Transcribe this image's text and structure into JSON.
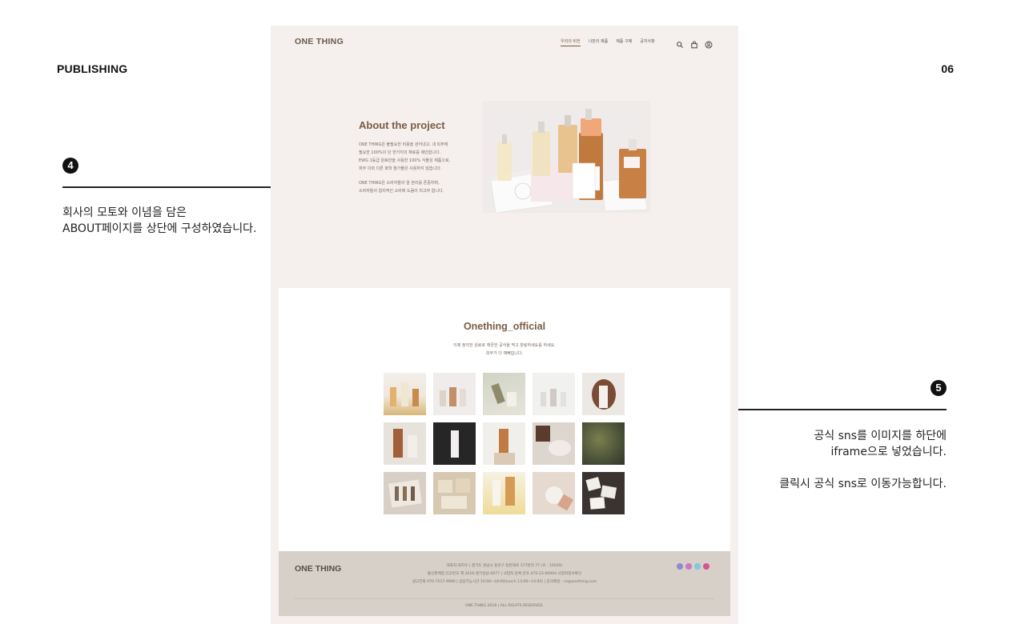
{
  "slide": {
    "section_label": "PUBLISHING",
    "page_number": "06"
  },
  "annotations": [
    {
      "badge": "4",
      "lines": [
        "회사의 모토와 이념을 담은",
        "ABOUT페이지를 상단에 구성하였습니다."
      ]
    },
    {
      "badge": "5",
      "lines": [
        "공식 sns를 이미지를 하단에",
        "iframe으로 넣었습니다.",
        "",
        "클릭시 공식 sns로 이동가능합니다."
      ]
    }
  ],
  "site": {
    "logo": "ONE THING",
    "nav": [
      "우리의 비전",
      "나만의 제품",
      "제품 구매",
      "공지사항"
    ],
    "nav_active_index": 0,
    "nav_icons": [
      "search-icon",
      "bag-icon",
      "user-icon"
    ],
    "about": {
      "title": "About the project",
      "paragraph1": [
        "ONE THING은 불필요한 비용을 걷어내고, 내 피부에",
        "필요한 100%의 단 한가지의 재료를 제안합니다.",
        "EWG 1등급 원료만을 사용한 100% 식물성 제품으로,",
        "피부 이외 다른 화학 첨가물은 사용하지 않습니다."
      ],
      "paragraph2": [
        "ONE THING은 소비자들의 알 권리를 존중하며,",
        "소비자들의 합리적인 소비에 도움이 되고자 합니다."
      ]
    },
    "instagram": {
      "title": "Onething_official",
      "subtitle": [
        "이제 정직한 원료로 깨끗한 공식을 찍고 힐링하세요를 하세요.",
        "피부가 더 예뻐집니다."
      ],
      "photo_count": 15
    },
    "footer": {
      "logo": "ONE THING",
      "info": [
        "대표자:최지우  |  경기도 성남시 동안구 동탄대로 177번지 77 (우 : 10019)",
        "통신판매업 신고번호 제 2016-경기성남-0077  |  사업자 등록 번호 472-23-00004 사업자정보확인",
        "광고전화 070-7517-9980  |  상담가능시간 10:00~18:00(lunch 13:00~14:00)  |  문의메일 : cs@onething.com"
      ],
      "sns_colors": [
        "#8a8ccf",
        "#c879c2",
        "#7ec9dd",
        "#d6548c"
      ],
      "copyright": "ONE THING 2018  |  ALL RIGHTS RESERVED."
    }
  }
}
